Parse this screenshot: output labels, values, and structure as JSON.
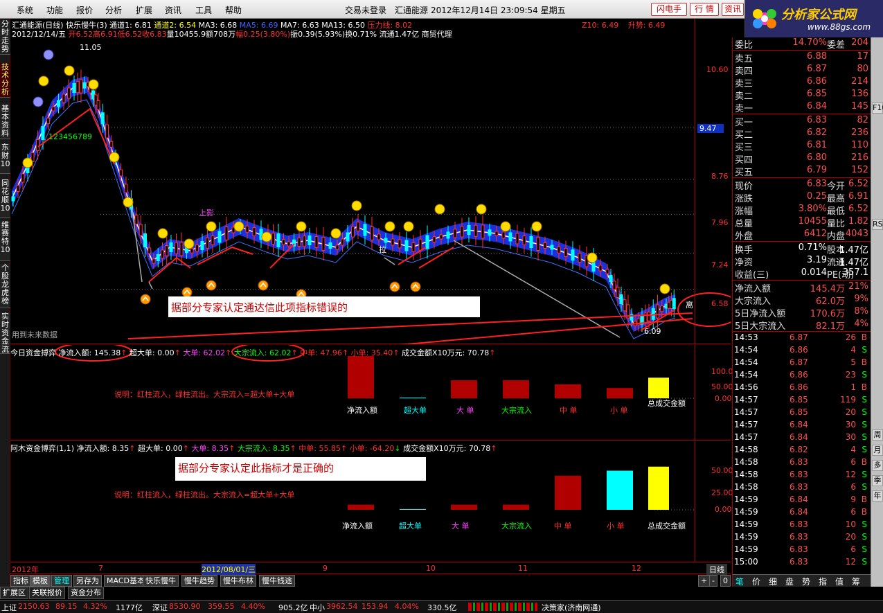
{
  "menu": [
    "系统",
    "功能",
    "报价",
    "分析",
    "扩展",
    "资讯",
    "工具",
    "帮助"
  ],
  "title": {
    "login": "交易未登录",
    "stock": "汇通能源",
    "datetime": "2012年12月14日 23:09:54 星期五"
  },
  "top_buttons": [
    "闪电手",
    "行 情",
    "资讯"
  ],
  "logo": {
    "name": "分析家公式网",
    "url": "www.88gs.com"
  },
  "left_tabs": [
    "分时走势",
    "技术分析",
    "基本资料",
    "东财10",
    "同花顺10",
    "维赛特10",
    "个股龙虎榜",
    "实时资金流"
  ],
  "main": {
    "row1": {
      "name": "汇通能源(日线) 快乐慢牛(3)",
      "t1": "通道1: 6.81",
      "t2": "通道2: 6.54",
      "ma3": "MA3: 6.68",
      "ma5": "MA5: 6.69",
      "ma7": "MA7: 6.63",
      "ma13": "MA13: 6.50",
      "pressure": "压力线: 8.02",
      "z10": "Z10: 6.49",
      "rise": "升势: 6.49"
    },
    "row2": {
      "date": "2012/12/14/五",
      "open": "开6.52",
      "high": "高6.91",
      "low": "低6.52",
      "close": "收6.83",
      "vol": "量10455.9",
      "amt": "额708万",
      "chg": "幅0.25(3.80%)",
      "amp": "振0.39(5.93%)",
      "turn": "换0.71% 流通1.47亿 商贸代理"
    },
    "price_axis": [
      "10.60",
      "9.47",
      "8.76",
      "7.96",
      "7.24",
      "6.58"
    ],
    "high_label": "11.05",
    "low_label": "6.09",
    "count_label": "123456789",
    "future_label": "用到未来数据",
    "upshadow": "上影",
    "pull": "拉",
    "lilian": "离",
    "x_labels": [
      "2012年",
      "7",
      "2012/08/01/三",
      "9",
      "10",
      "11",
      "12"
    ],
    "period": "日线"
  },
  "panel1": {
    "header": {
      "name": "今日资金搏弈",
      "net": "净流入额: 145.38",
      "super": "超大单: 0.00",
      "big": "大单: 62.02",
      "block": "大宗流入: 62.02",
      "mid": "中单: 47.96",
      "small": "小单: 35.40",
      "total": "成交金额X10万元: 70.78"
    },
    "desc": "说明：红柱流入，绿柱流出。大宗流入=超大单+大单",
    "note": "据部分专家认定通达信此项指标错误的",
    "axis": [
      "100.0",
      "50.00",
      "0.00"
    ],
    "labels": [
      "净流入额",
      "超大单",
      "大 单",
      "大宗流入",
      "中 单",
      "小 单",
      "总成交金额"
    ]
  },
  "panel2": {
    "header": {
      "name": "阿木资金博弈(1,1)",
      "net": "净流入额: 8.35",
      "super": "超大单: 0.00",
      "big": "大单: 8.35",
      "block": "大宗流入: 8.35",
      "mid": "中单: 55.85",
      "small": "小单: -64.20",
      "total": "成交金额X10万元: 70.78"
    },
    "desc": "说明：红柱流入，绿柱流出。大宗流入=超大单+大单",
    "note": "据部分专家认定此指标才是正确的",
    "axis": [
      "50.00",
      "25.00",
      "0.00"
    ],
    "labels": [
      "净流入额",
      "超大单",
      "大 单",
      "大宗流入",
      "中 单",
      "小 单",
      "总成交金额"
    ]
  },
  "bottom_tabs": [
    "指标",
    "模板",
    "管理",
    "另存为",
    "MACD基本",
    "快乐慢牛",
    "慢牛趋势",
    "慢牛布林",
    "慢牛钱途"
  ],
  "bottom_nav": [
    "扩展区",
    "关联报价",
    "资金分布"
  ],
  "right_panel": {
    "ratio": {
      "l": "委比",
      "v": "14.70%",
      "l2": "委差",
      "v2": "204"
    },
    "sells": [
      [
        "卖五",
        "6.88",
        "17"
      ],
      [
        "卖四",
        "6.87",
        "80"
      ],
      [
        "卖三",
        "6.86",
        "214"
      ],
      [
        "卖二",
        "6.85",
        "136"
      ],
      [
        "卖一",
        "6.84",
        "145"
      ]
    ],
    "buys": [
      [
        "买一",
        "6.83",
        "82"
      ],
      [
        "买二",
        "6.82",
        "236"
      ],
      [
        "买三",
        "6.81",
        "110"
      ],
      [
        "买四",
        "6.80",
        "216"
      ],
      [
        "买五",
        "6.79",
        "152"
      ]
    ],
    "stats": [
      [
        "现价",
        "6.83",
        "今开",
        "6.52"
      ],
      [
        "涨跌",
        "0.25",
        "最高",
        "6.91"
      ],
      [
        "涨幅",
        "3.80%",
        "最低",
        "6.52"
      ],
      [
        "总量",
        "10455",
        "量比",
        "1.82"
      ],
      [
        "外盘",
        "6412",
        "内盘",
        "4043"
      ]
    ],
    "stats2": [
      [
        "换手",
        "0.71%",
        "股本",
        "1.47亿"
      ],
      [
        "净资",
        "3.19",
        "流通",
        "1.47亿"
      ],
      [
        "收益(三)",
        "0.014",
        "PE(动)",
        "357.1"
      ]
    ],
    "flow": [
      [
        "净流入额",
        "145.4万",
        "21%"
      ],
      [
        "大宗流入",
        "62.0万",
        "9%"
      ],
      [
        "5日净流入额",
        "170.6万",
        "8%"
      ],
      [
        "5日大宗流入",
        "82.1万",
        "4%"
      ]
    ],
    "ticks": [
      [
        "14:53",
        "6.87",
        "26",
        "B"
      ],
      [
        "14:54",
        "6.86",
        "4",
        "S"
      ],
      [
        "14:54",
        "6.87",
        "5",
        "B"
      ],
      [
        "14:54",
        "6.86",
        "23",
        "S"
      ],
      [
        "14:56",
        "6.86",
        "1",
        "B"
      ],
      [
        "14:57",
        "6.85",
        "119",
        "S"
      ],
      [
        "14:57",
        "6.85",
        "20",
        "S"
      ],
      [
        "14:57",
        "6.84",
        "30",
        "S"
      ],
      [
        "14:57",
        "6.84",
        "30",
        "S"
      ],
      [
        "14:58",
        "6.82",
        "4",
        "S"
      ],
      [
        "14:58",
        "6.83",
        "6",
        "B"
      ],
      [
        "14:58",
        "6.83",
        "12",
        "S"
      ],
      [
        "14:58",
        "6.83",
        "6",
        "S"
      ],
      [
        "14:59",
        "6.84",
        "9",
        "B"
      ],
      [
        "14:59",
        "6.84",
        "6",
        "B"
      ],
      [
        "14:59",
        "6.83",
        "10",
        "S"
      ],
      [
        "14:59",
        "6.83",
        "20",
        "S"
      ],
      [
        "14:59",
        "6.83",
        "6",
        "S"
      ],
      [
        "15:00",
        "6.83",
        "12",
        "S"
      ]
    ],
    "bottom_tabs": [
      "笔",
      "价",
      "细",
      "盘",
      "势",
      "指",
      "值",
      "筹"
    ]
  },
  "side_icons": [
    "F10",
    "RSI",
    "周",
    "月",
    "多",
    "季",
    "年"
  ],
  "status": {
    "sh": "上证",
    "sh_v": "2150.63",
    "sh_c": "89.15",
    "sh_p": "4.32%",
    "sh_a": "1177亿",
    "sz": "深证",
    "sz_v": "8530.90",
    "sz_c": "359.55",
    "sz_p": "4.40%",
    "sz_a": "905.2亿",
    "zx": "中小",
    "zx_v": "3962.54",
    "zx_c": "153.94",
    "zx_p": "4.04%",
    "zx_a": "330.5亿",
    "broker": "决策家(济南网通)"
  },
  "colors": {
    "bg": "#000000",
    "red": "#ff3030",
    "green": "#00ff00",
    "blue_band": "#2040ff",
    "yellow": "#ffff00",
    "cyan": "#00ffff",
    "bar_red": "#b00000"
  }
}
